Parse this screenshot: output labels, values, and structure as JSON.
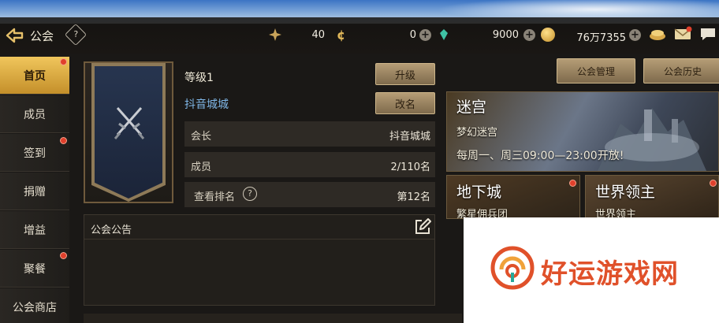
{
  "header": {
    "title": "公会",
    "help_glyph": "?",
    "resources": [
      {
        "icon": "stamina-icon",
        "value": "40"
      },
      {
        "icon": "coin-icon",
        "value": "0"
      },
      {
        "icon": "crystal-icon",
        "value": "9000"
      },
      {
        "icon": "gold-icon",
        "value": "76万7355"
      }
    ]
  },
  "sidebar": {
    "items": [
      {
        "label": "首页",
        "active": true,
        "badge": true
      },
      {
        "label": "成员",
        "active": false,
        "badge": false
      },
      {
        "label": "签到",
        "active": false,
        "badge": true
      },
      {
        "label": "捐赠",
        "active": false,
        "badge": false
      },
      {
        "label": "增益",
        "active": false,
        "badge": false
      },
      {
        "label": "聚餐",
        "active": false,
        "badge": true
      },
      {
        "label": "公会商店",
        "active": false,
        "badge": false
      }
    ]
  },
  "guild": {
    "level": "等级1",
    "name": "抖音城城",
    "upgrade_label": "升级",
    "rename_label": "改名",
    "rows": [
      {
        "key": "会长",
        "value": "抖音城城"
      },
      {
        "key": "成员",
        "value": "2/110名"
      },
      {
        "key": "查看排名",
        "value": "第12名"
      }
    ],
    "rank_help_glyph": "?"
  },
  "notice": {
    "title": "公会公告"
  },
  "actions": {
    "manage_label": "公会管理",
    "history_label": "公会历史"
  },
  "cards": {
    "maze": {
      "title": "迷宫",
      "subtitle": "梦幻迷宫",
      "schedule": "每周一、周三09:00—23:00开放!"
    },
    "dungeon": {
      "title": "地下城",
      "subtitle": "繁星佣兵团"
    },
    "world_boss": {
      "title": "世界领主",
      "subtitle": "世界领主"
    }
  },
  "watermark": {
    "text": "好运游戏网"
  },
  "colors": {
    "accent_gold": "#e6c06a",
    "active_tab": "#f0c65c",
    "guild_name": "#7fb6e6",
    "badge_red": "#e0402c",
    "watermark": "#e0512a"
  }
}
